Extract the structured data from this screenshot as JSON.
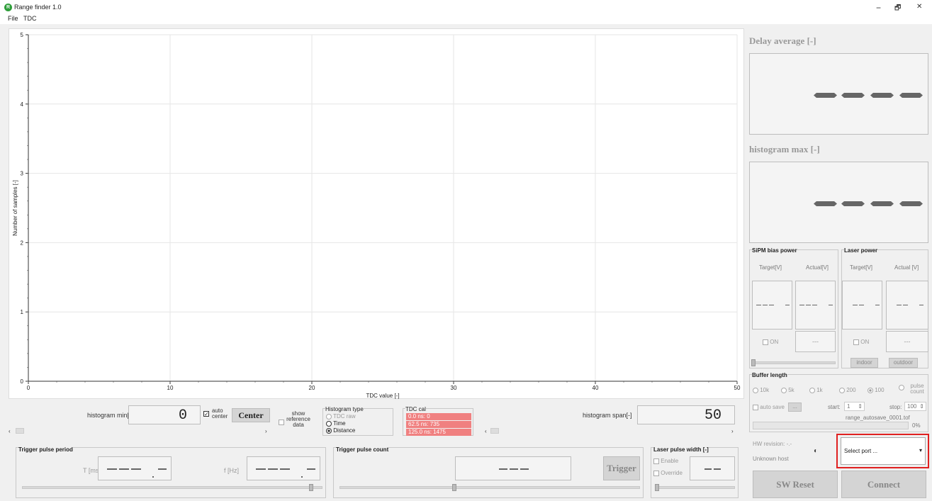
{
  "window": {
    "title": "Range finder 1.0",
    "min": "−",
    "restore": "🗗",
    "close": "✕"
  },
  "menu": {
    "file": "File",
    "tdc": "TDC"
  },
  "chart_data": {
    "type": "scatter",
    "series": [],
    "xlabel": "TDC value [-]",
    "ylabel": "Number of samples [-]",
    "xlim": [
      0,
      50
    ],
    "ylim": [
      0,
      5
    ],
    "xticks": [
      "0",
      "10",
      "20",
      "30",
      "40",
      "50"
    ],
    "yticks": [
      "0",
      "1",
      "2",
      "3",
      "4",
      "5"
    ],
    "grid": true
  },
  "histogram": {
    "min_label": "histogram min[-]",
    "min_value": "0",
    "auto_center": "auto center",
    "center_btn": "Center",
    "show_reference": "show reference data",
    "span_label": "histogram span[-]",
    "span_value": "50"
  },
  "histogram_type": {
    "title": "Histogram type",
    "options": [
      "TDC raw",
      "Time",
      "Distance"
    ],
    "selected": "Distance"
  },
  "tdc_cal": {
    "title": "TDC cal",
    "rows": [
      "0.0 ns: 0",
      "62.5 ns: 735",
      "125.0 ns: 1475"
    ]
  },
  "trigger_period": {
    "title": "Trigger pulse period",
    "t_label": "T [ms]",
    "f_label": "f [Hz]"
  },
  "trigger_count": {
    "title": "Trigger pulse count",
    "trigger_btn": "Trigger"
  },
  "laser_width": {
    "title": "Laser pulse width [-]",
    "enable": "Enable",
    "override": "Override"
  },
  "right": {
    "delay_title": "Delay average [-]",
    "hist_max_title": "histogram max [-]",
    "sipm": {
      "title": "SiPM bias power",
      "target": "Target[V]",
      "actual": "Actual[V]",
      "on": "ON",
      "btn": "---"
    },
    "laser": {
      "title": "Laser power",
      "target": "Target[V]",
      "actual": "Actual [V]",
      "on": "ON",
      "btn": "---",
      "indoor": "indoor",
      "outdoor": "outdoor"
    },
    "buffer": {
      "title": "Buffer length",
      "options": [
        "10k",
        "5k",
        "1k",
        "200",
        "100",
        "pulse count"
      ],
      "selected": "100",
      "auto_save": "auto save",
      "browse": "...",
      "start_label": "start:",
      "start_value": "1",
      "stop_label": "stop:",
      "stop_value": "100",
      "filename": "range_autosave_0001.tof",
      "progress": "0%"
    },
    "hw_revision": "HW revision: -.-",
    "unknown_host": "Unknown host",
    "select_port": "Select port ...",
    "sw_reset": "SW Reset",
    "connect": "Connect"
  },
  "colors": {
    "accent_red": "#e02020",
    "cal_red": "#f08080"
  }
}
